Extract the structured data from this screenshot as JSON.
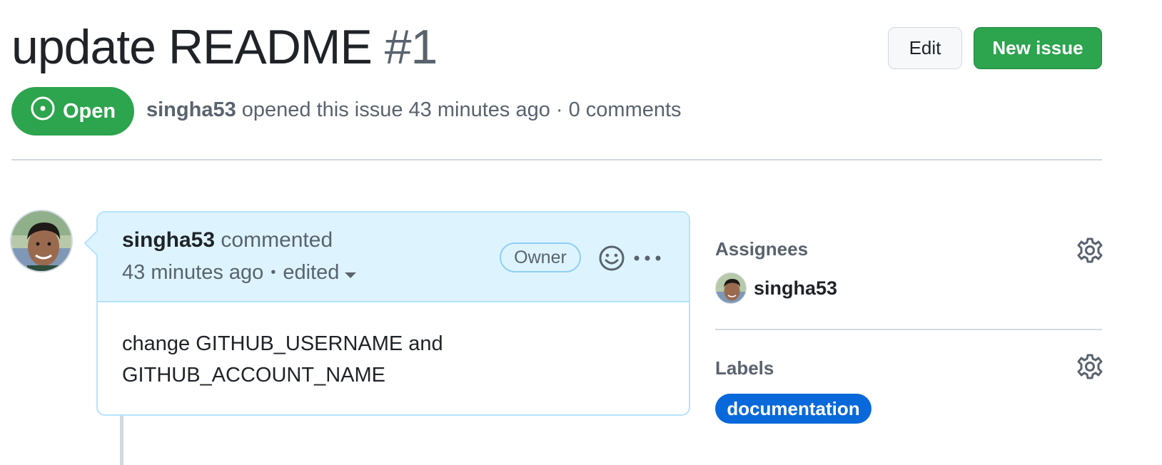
{
  "issue": {
    "title": "update README",
    "number": "#1",
    "state": "Open",
    "author": "singha53",
    "meta_text": " opened this issue 43 minutes ago · 0 comments"
  },
  "header_actions": {
    "edit_label": "Edit",
    "new_issue_label": "New issue"
  },
  "comment": {
    "author": "singha53",
    "action": " commented",
    "time": "43 minutes ago",
    "separator": "•",
    "edited": "edited",
    "role_badge": "Owner",
    "body_line1": "change GITHUB_USERNAME and",
    "body_line2": "GITHUB_ACCOUNT_NAME"
  },
  "sidebar": {
    "assignees_heading": "Assignees",
    "assignee_name": "singha53",
    "labels_heading": "Labels",
    "label": "documentation"
  },
  "colors": {
    "open_green": "#2da44e",
    "comment_header_bg": "#ddf4ff",
    "label_blue": "#0969da"
  },
  "icons": [
    "issue-opened-icon",
    "smiley-icon",
    "kebab-horizontal-icon",
    "gear-icon",
    "caret-down-icon"
  ]
}
